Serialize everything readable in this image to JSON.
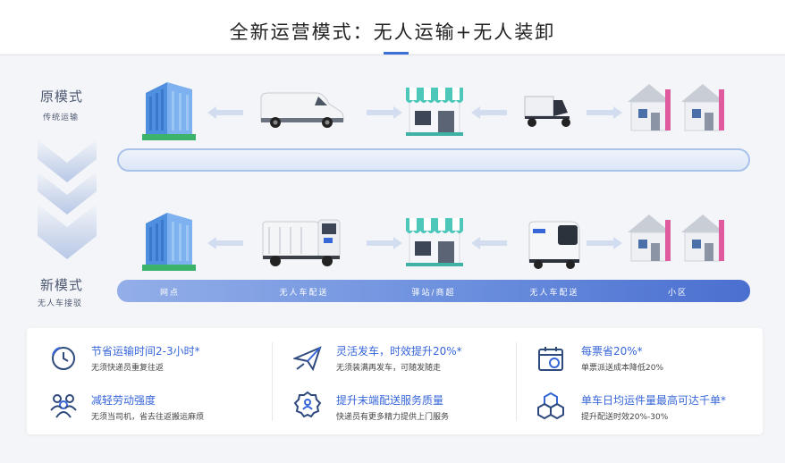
{
  "title": "全新运营模式：无人运输+无人装卸",
  "old_mode": {
    "label": "原模式",
    "sub": "传统运输"
  },
  "new_mode": {
    "label": "新模式",
    "sub": "无人车接驳"
  },
  "new_bar_labels": [
    "网点",
    "无人车配送",
    "驿站/商超",
    "无人车配送",
    "小区"
  ],
  "features": [
    {
      "icon": "clock-icon",
      "title": "节省运输时间2-3小时*",
      "desc": "无须快递员重复往返"
    },
    {
      "icon": "people-icon",
      "title": "减轻劳动强度",
      "desc": "无须当司机，省去往返搬运麻烦"
    },
    {
      "icon": "paper-plane-icon",
      "title": "灵活发车，时效提升20%*",
      "desc": "无须装满再发车，可随发随走"
    },
    {
      "icon": "quality-badge-icon",
      "title": "提升末端配送服务质量",
      "desc": "快递员有更多精力提供上门服务"
    },
    {
      "icon": "calendar-money-icon",
      "title": "每票省20%*",
      "desc": "单票派送成本降低20%"
    },
    {
      "icon": "cubes-icon",
      "title": "单车日均运件量最高可达千单*",
      "desc": "提升配送时效20%-30%"
    }
  ],
  "colors": {
    "accent": "#3766d8",
    "bar_light": "#dde7f7",
    "bar_dark": "#4a6fcf",
    "awning": "#4ec7bb",
    "roof_pink": "#e05a9e"
  }
}
